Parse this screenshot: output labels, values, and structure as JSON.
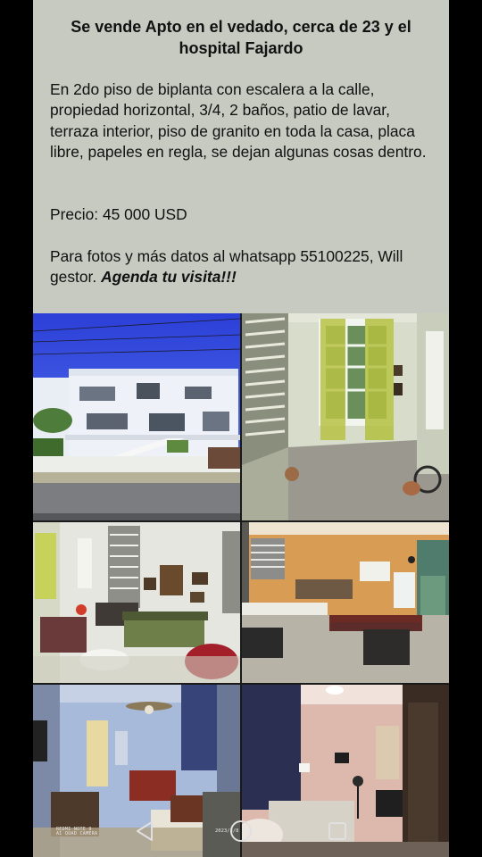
{
  "post": {
    "title": "Se vende Apto en el vedado, cerca de 23 y el hospital Fajardo",
    "description": "En 2do piso de biplanta con escalera a la calle, propiedad horizontal, 3/4, 2 baños, patio de lavar, terraza interior, piso de granito en toda la casa, placa libre, papeles en regla, se dejan algunas cosas dentro.",
    "price": "Precio: 45 000 USD",
    "contact": "Para fotos y más datos al whatsapp 55100225, Will gestor.",
    "cta": "Agenda tu visita!!!"
  },
  "photo_stamp": {
    "line1": "REDMI NOTE 9",
    "line2": "AI QUAD CAMERA",
    "date": "2023/3/8  13:38"
  },
  "photos": [
    {
      "subject": "building-exterior"
    },
    {
      "subject": "room-window"
    },
    {
      "subject": "living-room"
    },
    {
      "subject": "dining-kitchen"
    },
    {
      "subject": "bedroom-fan"
    },
    {
      "subject": "bedroom-blue-curtain"
    }
  ],
  "navbar": {
    "icons": [
      "back-triangle-icon",
      "home-circle-icon",
      "recents-square-icon"
    ]
  },
  "colors": {
    "text_panel": "#c6cac1",
    "background": "#000000",
    "nav_icons": "#e0e0e0"
  }
}
